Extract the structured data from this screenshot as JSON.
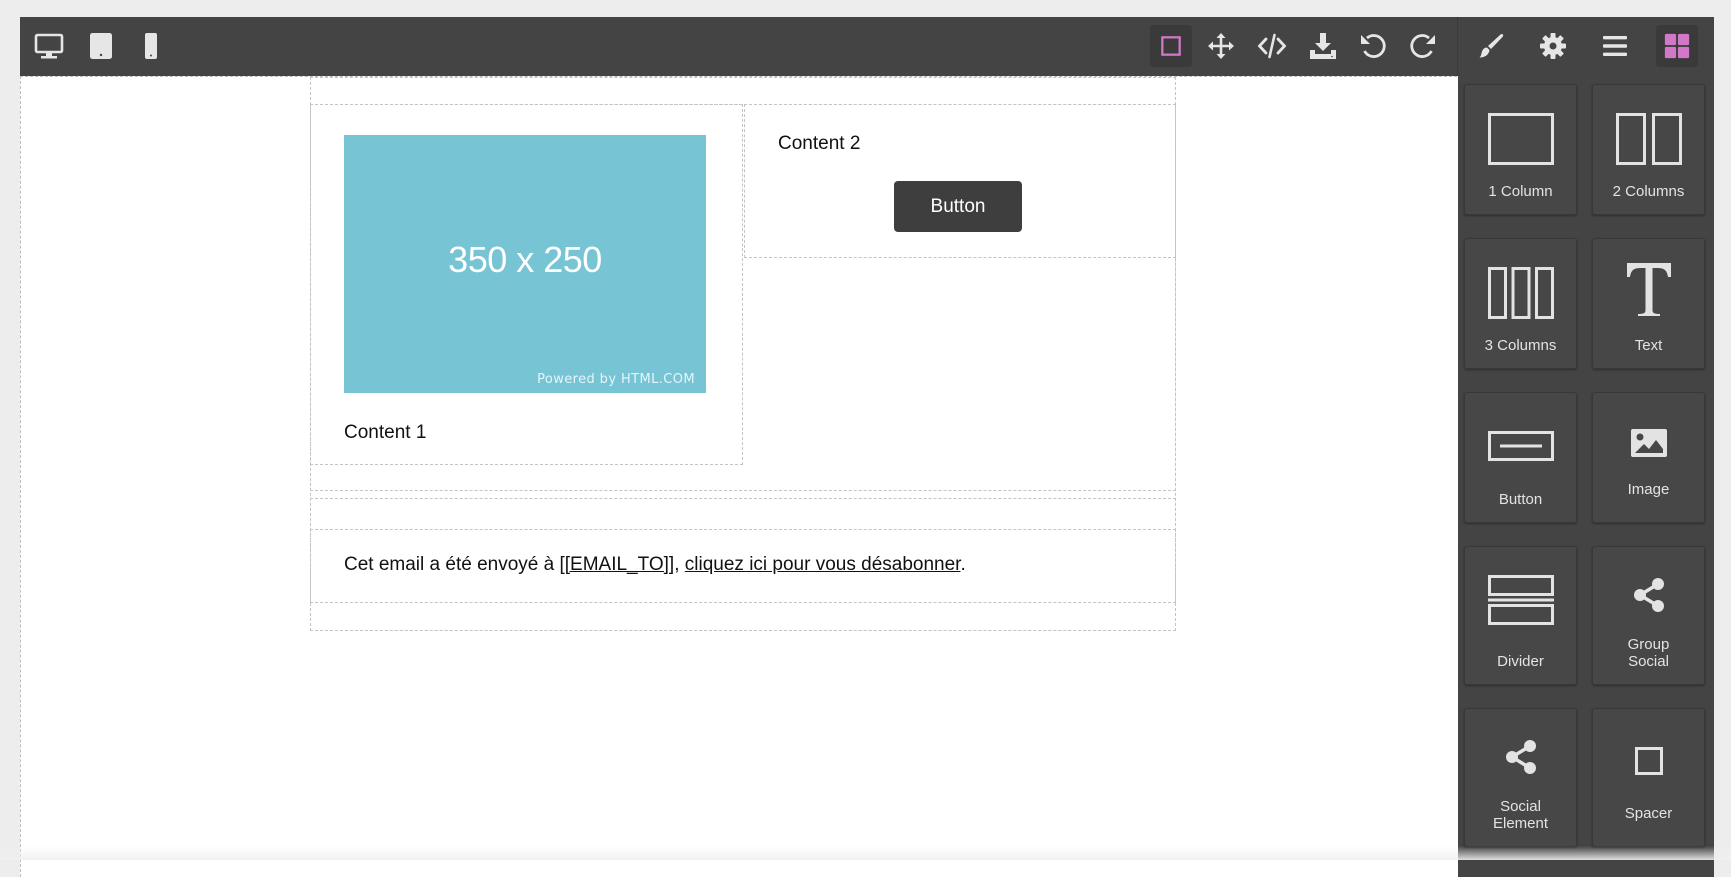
{
  "toolbar": {
    "devices": [
      {
        "icon": "desktop-icon",
        "name": "device-desktop"
      },
      {
        "icon": "tablet-icon",
        "name": "device-tablet"
      },
      {
        "icon": "mobile-icon",
        "name": "device-mobile"
      }
    ],
    "actions": [
      {
        "icon": "square-outline-icon",
        "name": "sw-visibility",
        "active": true
      },
      {
        "icon": "move-icon",
        "name": "move-tool"
      },
      {
        "icon": "code-icon",
        "name": "view-code"
      },
      {
        "icon": "download-icon",
        "name": "export"
      },
      {
        "icon": "undo-icon",
        "name": "undo"
      },
      {
        "icon": "redo-icon",
        "name": "redo"
      }
    ],
    "panels": [
      {
        "icon": "brush-icon",
        "name": "style-manager"
      },
      {
        "icon": "gear-icon",
        "name": "settings"
      },
      {
        "icon": "menu-icon",
        "name": "layer-manager"
      },
      {
        "icon": "blocks-icon",
        "name": "blocks",
        "active": true
      }
    ],
    "accent_color": "#d278c9"
  },
  "canvas": {
    "image_placeholder": {
      "dimensions": "350 x 250",
      "credit": "Powered by HTML.COM",
      "color": "#77c4d5"
    },
    "content1": "Content 1",
    "content2": "Content 2",
    "button_label": "Button",
    "footer": {
      "prefix": "Cet email a été envoyé à ",
      "email_tag": "[[EMAIL_TO]]",
      "separator": ", ",
      "unsubscribe_link": "cliquez ici pour vous désabonner",
      "suffix": "."
    }
  },
  "blocks": [
    {
      "label": "1 Column",
      "icon": "one-column-icon"
    },
    {
      "label": "2 Columns",
      "icon": "two-columns-icon"
    },
    {
      "label": "3 Columns",
      "icon": "three-columns-icon"
    },
    {
      "label": "Text",
      "icon": "text-icon"
    },
    {
      "label": "Button",
      "icon": "button-block-icon"
    },
    {
      "label": "Image",
      "icon": "image-icon"
    },
    {
      "label": "Divider",
      "icon": "divider-icon"
    },
    {
      "label": "Group\nSocial",
      "line1": "Group",
      "line2": "Social",
      "icon": "share-icon"
    },
    {
      "label": "Social Element",
      "line1": "Social",
      "line2": "Element",
      "icon": "share-icon"
    },
    {
      "label": "Spacer",
      "icon": "spacer-icon"
    }
  ]
}
